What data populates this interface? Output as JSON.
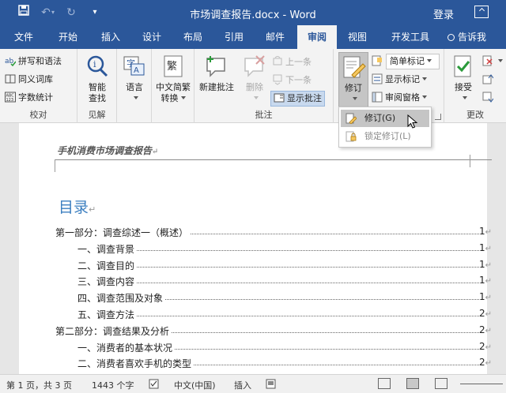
{
  "window": {
    "title": "市场调查报告.docx - Word",
    "login": "登录"
  },
  "tabs": [
    "文件",
    "开始",
    "插入",
    "设计",
    "布局",
    "引用",
    "邮件",
    "审阅",
    "视图",
    "开发工具"
  ],
  "active_tab": "审阅",
  "tell_me": "告诉我",
  "ribbon": {
    "proofing": {
      "label": "校对",
      "spelling": "拼写和语法",
      "thesaurus": "同义词库",
      "word_count": "字数统计"
    },
    "insights": {
      "label": "见解",
      "smart_lookup_line1": "智能",
      "smart_lookup_line2": "查找"
    },
    "language": {
      "label": "语言"
    },
    "chinese_conv": {
      "line1": "中文简繁",
      "line2": "转换"
    },
    "comments": {
      "label": "批注",
      "new_comment": "新建批注",
      "delete": "删除",
      "previous": "上一条",
      "next": "下一条",
      "show_comments": "显示批注"
    },
    "tracking": {
      "track_changes": "修订",
      "simple_markup": "简单标记",
      "show_markup": "显示标记",
      "reviewing_pane": "审阅窗格"
    },
    "changes": {
      "label": "更改",
      "accept": "接受"
    }
  },
  "dropdown": {
    "items": [
      {
        "label": "修订(G)",
        "hover": true
      },
      {
        "label": "锁定修订(L)",
        "hover": false
      }
    ]
  },
  "document": {
    "header": "手机消费市场调查报告",
    "toc_title": "目录",
    "toc": [
      {
        "text": "第一部分：调查综述一（概述）",
        "page": "1",
        "level": 1
      },
      {
        "text": "一、调查背景",
        "page": "1",
        "level": 2
      },
      {
        "text": "二、调查目的",
        "page": "1",
        "level": 2
      },
      {
        "text": "三、调查内容",
        "page": "1",
        "level": 2
      },
      {
        "text": "四、调查范围及对象",
        "page": "1",
        "level": 2
      },
      {
        "text": "五、调查方法",
        "page": "2",
        "level": 2
      },
      {
        "text": "第二部分：调查结果及分析",
        "page": "2",
        "level": 1
      },
      {
        "text": "一、消费者的基本状况",
        "page": "2",
        "level": 2
      },
      {
        "text": "二、消费者喜欢手机的类型",
        "page": "2",
        "level": 2
      }
    ]
  },
  "status": {
    "page": "第 1 页，共 3 页",
    "words": "1443 个字",
    "language": "中文(中国)",
    "mode": "插入"
  },
  "colors": {
    "brand": "#2b579a",
    "toc_title": "#3c7fc0"
  }
}
